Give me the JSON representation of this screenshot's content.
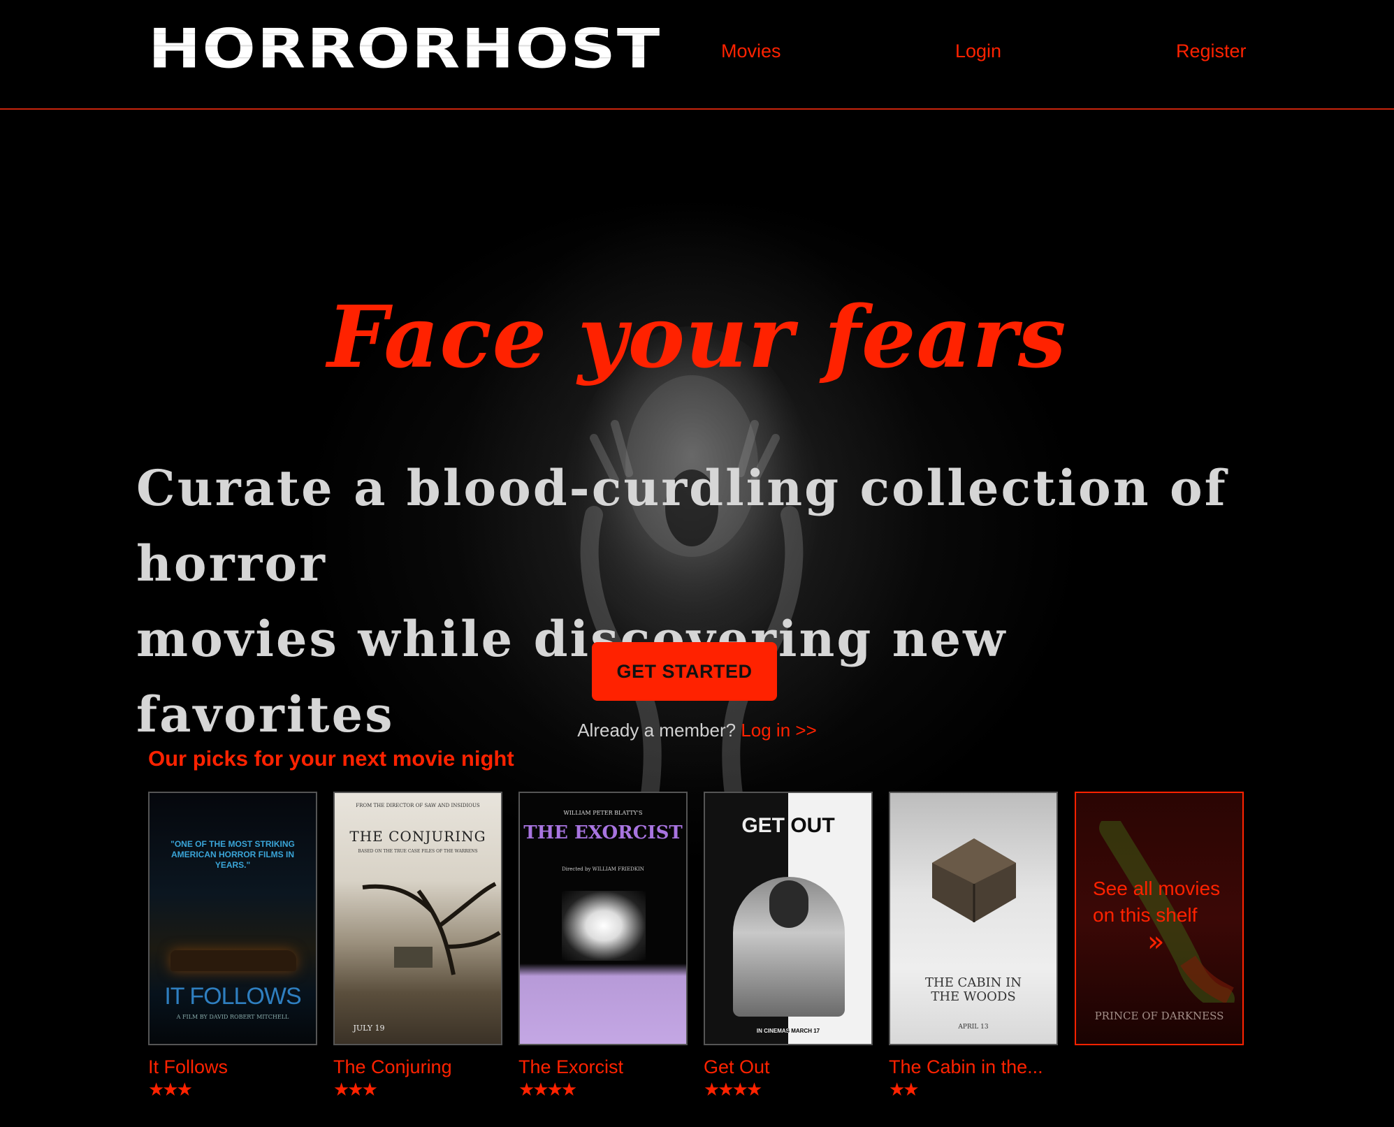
{
  "header": {
    "logo": "HORRORHOST",
    "nav": [
      "Movies",
      "Login",
      "Register"
    ]
  },
  "hero": {
    "title": "Face your fears",
    "subtitle_line1": "Curate a blood-curdling collection of horror",
    "subtitle_line2": "movies while discovering new favorites",
    "cta_label": "GET STARTED",
    "member_text": "Already a member? ",
    "login_link": "Log in >>"
  },
  "picks": {
    "heading": "Our picks for your next movie night",
    "movies": [
      {
        "title": "It Follows",
        "rating": 3,
        "stars": "★★★",
        "poster_quote": "\"ONE OF THE MOST STRIKING AMERICAN HORROR FILMS IN YEARS.\"",
        "poster_name": "IT FOLLOWS",
        "poster_credit": "A FILM BY DAVID ROBERT MITCHELL"
      },
      {
        "title": "The Conjuring",
        "rating": 3,
        "stars": "★★★",
        "poster_tag": "FROM THE DIRECTOR OF SAW AND INSIDIOUS",
        "poster_name": "THE CONJURING",
        "poster_sub": "BASED ON THE TRUE CASE FILES OF THE WARRENS",
        "poster_date": "JULY 19"
      },
      {
        "title": "The Exorcist",
        "rating": 4,
        "stars": "★★★★",
        "poster_tag": "WILLIAM PETER BLATTY'S",
        "poster_name": "THE EXORCIST",
        "poster_sub": "Directed by WILLIAM FRIEDKIN"
      },
      {
        "title": "Get Out",
        "rating": 4,
        "stars": "★★★★",
        "poster_name": "GET OUT",
        "poster_sub": "IN CINEMAS MARCH 17"
      },
      {
        "title": "The Cabin in the...",
        "rating": 2,
        "stars": "★★",
        "poster_name": "THE CABIN IN THE WOODS",
        "poster_date": "APRIL 13"
      }
    ],
    "see_all": {
      "label": "See all movies on this shelf",
      "arrow": "»",
      "poster_name": "PRINCE OF DARKNESS"
    }
  },
  "colors": {
    "accent": "#ff2200",
    "background": "#000000",
    "subtitle": "#d6d6d6"
  }
}
